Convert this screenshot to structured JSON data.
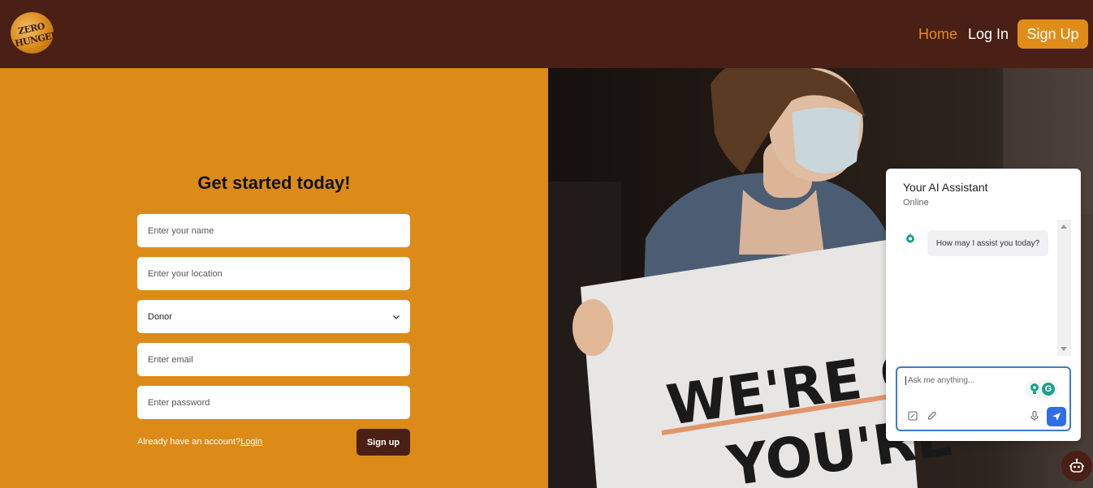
{
  "brand": {
    "logo_line1": "ZERO",
    "logo_line2": "HUNGER"
  },
  "nav": {
    "home": "Home",
    "login": "Log In",
    "signup": "Sign Up"
  },
  "form": {
    "title": "Get started today!",
    "name_placeholder": "Enter your name",
    "location_placeholder": "Enter your location",
    "role_selected": "Donor",
    "email_placeholder": "Enter email",
    "password_placeholder": "Enter password",
    "already_text": "Already have an account?",
    "login_link": "Login",
    "submit": "Sign up"
  },
  "hero_image": {
    "sign_line1": "WE'RE GLA",
    "sign_line2": "YOU'RE"
  },
  "chat": {
    "title": "Your AI Assistant",
    "status": "Online",
    "message": "How may I assist you today?",
    "input_placeholder": "Ask me anything..."
  },
  "colors": {
    "navbar": "#4a1f16",
    "panel": "#dc8b18",
    "accent": "#e08c18",
    "send": "#2e6ee8"
  }
}
